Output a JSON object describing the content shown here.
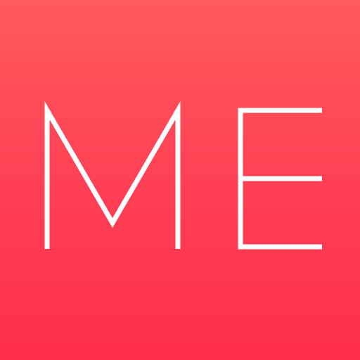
{
  "logo": {
    "text": "ME",
    "letters": [
      "M",
      "E"
    ],
    "colors": {
      "background_top": "#ff5a5c",
      "background_mid": "#ff3e55",
      "background_bottom": "#ff2e4b",
      "mark": "#ffffff"
    }
  }
}
